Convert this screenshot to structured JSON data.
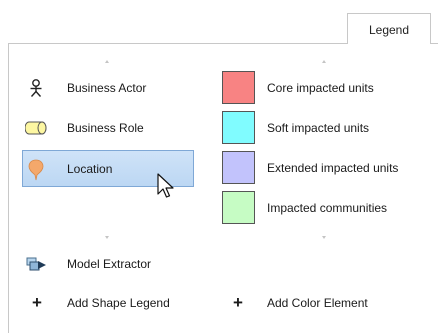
{
  "tab": {
    "label": "Legend"
  },
  "shape_legend": {
    "items": [
      {
        "label": "Business Actor",
        "icon": "business-actor-icon"
      },
      {
        "label": "Business Role",
        "icon": "business-role-icon"
      },
      {
        "label": "Location",
        "icon": "location-pin-icon",
        "selected": true
      }
    ],
    "model_extractor": {
      "label": "Model Extractor",
      "icon": "model-extractor-icon"
    },
    "add_label": "Add Shape Legend"
  },
  "color_legend": {
    "items": [
      {
        "label": "Core impacted units",
        "color": "#f88383"
      },
      {
        "label": "Soft impacted units",
        "color": "#80fcff"
      },
      {
        "label": "Extended impacted units",
        "color": "#c2c3fc"
      },
      {
        "label": "Impacted communities",
        "color": "#c6fcc4"
      }
    ],
    "add_label": "Add Color Element"
  },
  "colors": {
    "selection_bg": "#c6ddf6",
    "selection_border": "#7fa8d6",
    "location_pin": "#f4a86b"
  }
}
